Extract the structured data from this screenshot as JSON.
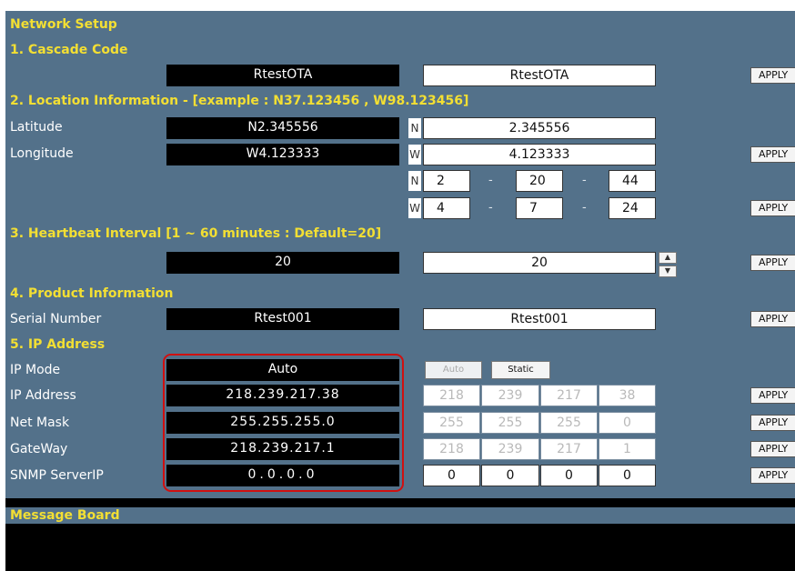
{
  "title": "Network Setup",
  "apply_label": "APPLY",
  "sections": {
    "cascade": {
      "header": "1. Cascade Code",
      "current": "RtestOTA",
      "input": "RtestOTA"
    },
    "location": {
      "header": "2. Location Information - [example : N37.123456 , W98.123456]",
      "latitude": {
        "label": "Latitude",
        "current": "N2.345556",
        "dir": "N",
        "input": "2.345556"
      },
      "longitude": {
        "label": "Longitude",
        "current": "W4.123333",
        "dir": "W",
        "input": "4.123333"
      },
      "dms_lat": {
        "dir": "N",
        "deg": "2",
        "min": "20",
        "sec": "44"
      },
      "dms_lon": {
        "dir": "W",
        "deg": "4",
        "min": "7",
        "sec": "24"
      },
      "dash": "-"
    },
    "heartbeat": {
      "header": "3. Heartbeat Interval [1 ~ 60 minutes : Default=20]",
      "current": "20",
      "input": "20"
    },
    "product": {
      "header": "4. Product Information",
      "serial_label": "Serial Number",
      "current": "Rtest001",
      "input": "Rtest001"
    },
    "ip": {
      "header": "5. IP Address",
      "mode": {
        "label": "IP Mode",
        "current": "Auto",
        "auto_btn": "Auto",
        "static_btn": "Static"
      },
      "address": {
        "label": "IP Address",
        "current": "218.239.217.38",
        "octets": [
          "218",
          "239",
          "217",
          "38"
        ]
      },
      "netmask": {
        "label": "Net Mask",
        "current": "255.255.255.0",
        "octets": [
          "255",
          "255",
          "255",
          "0"
        ]
      },
      "gateway": {
        "label": "GateWay",
        "current": "218.239.217.1",
        "octets": [
          "218",
          "239",
          "217",
          "1"
        ]
      },
      "snmp": {
        "label": "SNMP ServerIP",
        "current": "0.0.0.0",
        "octets": [
          "0",
          "0",
          "0",
          "0"
        ]
      }
    }
  },
  "message_board": {
    "header": "Message Board"
  }
}
